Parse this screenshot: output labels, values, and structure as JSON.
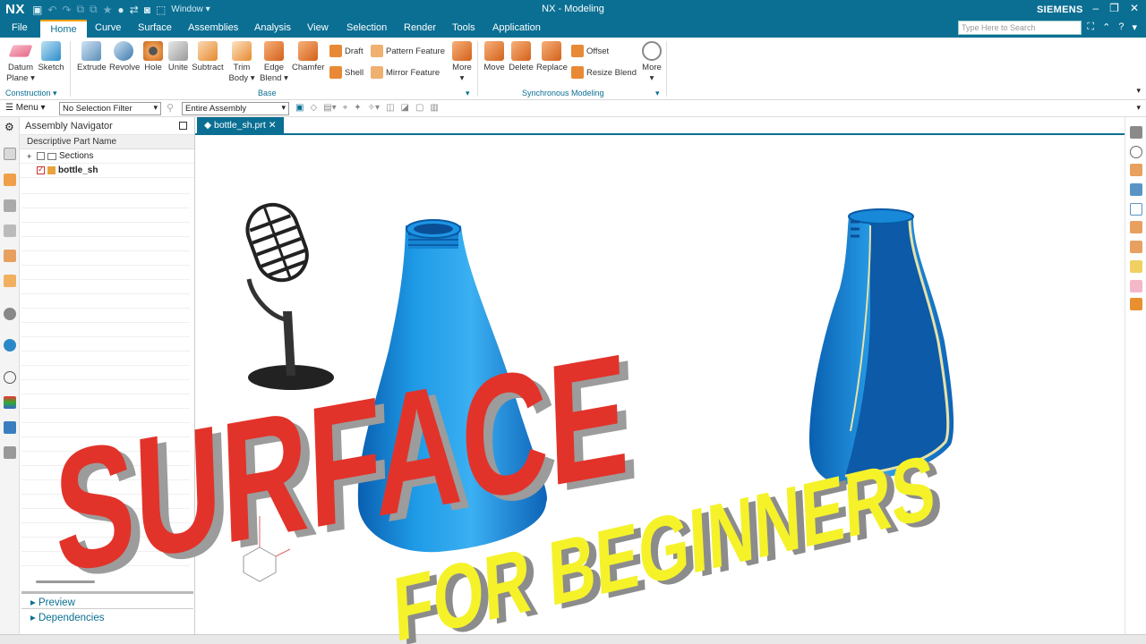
{
  "app": {
    "logo": "NX",
    "title": "NX - Modeling",
    "brand": "SIEMENS",
    "window_menu": "Window"
  },
  "menu": {
    "tabs": [
      "File",
      "Home",
      "Curve",
      "Surface",
      "Assemblies",
      "Analysis",
      "View",
      "Selection",
      "Render",
      "Tools",
      "Application"
    ],
    "active": "Home",
    "search_placeholder": "Type Here to Search"
  },
  "ribbon": {
    "construction": {
      "datum_line1": "Datum",
      "datum_line2": "Plane",
      "sketch": "Sketch",
      "group": "Construction"
    },
    "base": {
      "extrude": "Extrude",
      "revolve": "Revolve",
      "hole": "Hole",
      "unite": "Unite",
      "subtract": "Subtract",
      "trim_line1": "Trim",
      "trim_line2": "Body",
      "edge_line1": "Edge",
      "edge_line2": "Blend",
      "chamfer": "Chamfer",
      "draft": "Draft",
      "shell": "Shell",
      "pattern": "Pattern Feature",
      "mirror": "Mirror Feature",
      "more": "More",
      "group": "Base"
    },
    "sync": {
      "move": "Move",
      "delete": "Delete",
      "replace": "Replace",
      "offset": "Offset",
      "resize": "Resize Blend",
      "more": "More",
      "group": "Synchronous Modeling"
    }
  },
  "toolbar": {
    "menu": "Menu",
    "filter": "No Selection Filter",
    "scope": "Entire Assembly"
  },
  "navigator": {
    "title": "Assembly Navigator",
    "column": "Descriptive Part Name",
    "items": [
      {
        "label": "Sections",
        "bold": false
      },
      {
        "label": "bottle_sh",
        "bold": true
      }
    ],
    "preview": "Preview",
    "dependencies": "Dependencies"
  },
  "document": {
    "tab": "bottle_sh.prt"
  },
  "overlay": {
    "word1": "SURFACE",
    "word2": "FOR BEGINNERS"
  },
  "colors": {
    "titlebar": "#0b6f93",
    "accent": "#f2a100",
    "bottle": "#1a8fdc",
    "red": "#e2332a",
    "yellow": "#f5f22a"
  }
}
